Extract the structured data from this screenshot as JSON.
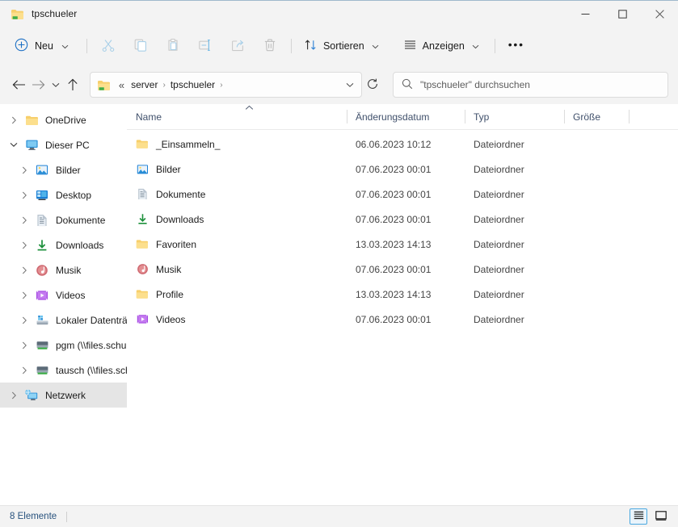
{
  "window": {
    "title": "tpschueler",
    "title_icon": "network-folder-icon",
    "controls": {
      "minimize": "minimize-icon",
      "maximize": "maximize-icon",
      "close": "close-icon"
    }
  },
  "toolbar": {
    "new_label": "Neu",
    "cut_tooltip": "Ausschneiden",
    "copy_tooltip": "Kopieren",
    "paste_tooltip": "Einfügen",
    "rename_tooltip": "Umbenennen",
    "share_tooltip": "Freigeben",
    "delete_tooltip": "Löschen",
    "sort_label": "Sortieren",
    "view_label": "Anzeigen",
    "more_label": "•••"
  },
  "address": {
    "back_icon": "back-arrow-icon",
    "forward_icon": "forward-arrow-icon",
    "recent_icon": "chevron-down-icon",
    "up_icon": "up-arrow-icon",
    "path_icon": "network-folder-icon",
    "overflow": "«",
    "crumbs": [
      "server",
      "tpschueler"
    ],
    "separator": "›",
    "dropdown_icon": "chevron-down-icon",
    "refresh_icon": "refresh-icon"
  },
  "search": {
    "icon": "search-icon",
    "placeholder": "\"tpschueler\" durchsuchen",
    "value": ""
  },
  "sidebar": {
    "items": [
      {
        "label": "OneDrive",
        "icon": "folder-icon",
        "level": 1,
        "expanded": false,
        "selected": false
      },
      {
        "label": "Dieser PC",
        "icon": "this-pc-icon",
        "level": 1,
        "expanded": true,
        "selected": false
      },
      {
        "label": "Bilder",
        "icon": "pictures-icon",
        "level": 2,
        "expanded": false,
        "selected": false
      },
      {
        "label": "Desktop",
        "icon": "desktop-icon",
        "level": 2,
        "expanded": false,
        "selected": false
      },
      {
        "label": "Dokumente",
        "icon": "documents-icon",
        "level": 2,
        "expanded": false,
        "selected": false
      },
      {
        "label": "Downloads",
        "icon": "downloads-icon",
        "level": 2,
        "expanded": false,
        "selected": false
      },
      {
        "label": "Musik",
        "icon": "music-icon",
        "level": 2,
        "expanded": false,
        "selected": false
      },
      {
        "label": "Videos",
        "icon": "videos-icon",
        "level": 2,
        "expanded": false,
        "selected": false
      },
      {
        "label": "Lokaler Datenträger",
        "icon": "local-disk-icon",
        "level": 2,
        "expanded": false,
        "selected": false
      },
      {
        "label": "pgm (\\\\files.schule",
        "icon": "network-drive-icon",
        "level": 2,
        "expanded": false,
        "selected": false
      },
      {
        "label": "tausch (\\\\files.schu",
        "icon": "network-drive-icon",
        "level": 2,
        "expanded": false,
        "selected": false
      },
      {
        "label": "Netzwerk",
        "icon": "network-icon",
        "level": 1,
        "expanded": false,
        "selected": true
      }
    ]
  },
  "filelist": {
    "columns": [
      {
        "label": "Name",
        "sorted": "asc"
      },
      {
        "label": "Änderungsdatum",
        "sorted": ""
      },
      {
        "label": "Typ",
        "sorted": ""
      },
      {
        "label": "Größe",
        "sorted": ""
      }
    ],
    "rows": [
      {
        "name": "_Einsammeln_",
        "icon": "folder-icon",
        "modified": "06.06.2023 10:12",
        "type": "Dateiordner",
        "size": ""
      },
      {
        "name": "Bilder",
        "icon": "pictures-icon",
        "modified": "07.06.2023 00:01",
        "type": "Dateiordner",
        "size": ""
      },
      {
        "name": "Dokumente",
        "icon": "documents-icon",
        "modified": "07.06.2023 00:01",
        "type": "Dateiordner",
        "size": ""
      },
      {
        "name": "Downloads",
        "icon": "downloads-icon",
        "modified": "07.06.2023 00:01",
        "type": "Dateiordner",
        "size": ""
      },
      {
        "name": "Favoriten",
        "icon": "folder-icon",
        "modified": "13.03.2023 14:13",
        "type": "Dateiordner",
        "size": ""
      },
      {
        "name": "Musik",
        "icon": "music-icon",
        "modified": "07.06.2023 00:01",
        "type": "Dateiordner",
        "size": ""
      },
      {
        "name": "Profile",
        "icon": "folder-icon",
        "modified": "13.03.2023 14:13",
        "type": "Dateiordner",
        "size": ""
      },
      {
        "name": "Videos",
        "icon": "videos-icon",
        "modified": "07.06.2023 00:01",
        "type": "Dateiordner",
        "size": ""
      }
    ]
  },
  "statusbar": {
    "item_count": "8 Elemente",
    "view_details_icon": "details-view-icon",
    "view_tiles_icon": "large-icons-view-icon",
    "selected_view": "details"
  },
  "colors": {
    "accent": "#4aa8e0",
    "chrome": "#f3f3f3",
    "folder": "#f5c75d",
    "text": "#1b1b1b",
    "header_text": "#40506b",
    "status_text": "#28527d"
  }
}
